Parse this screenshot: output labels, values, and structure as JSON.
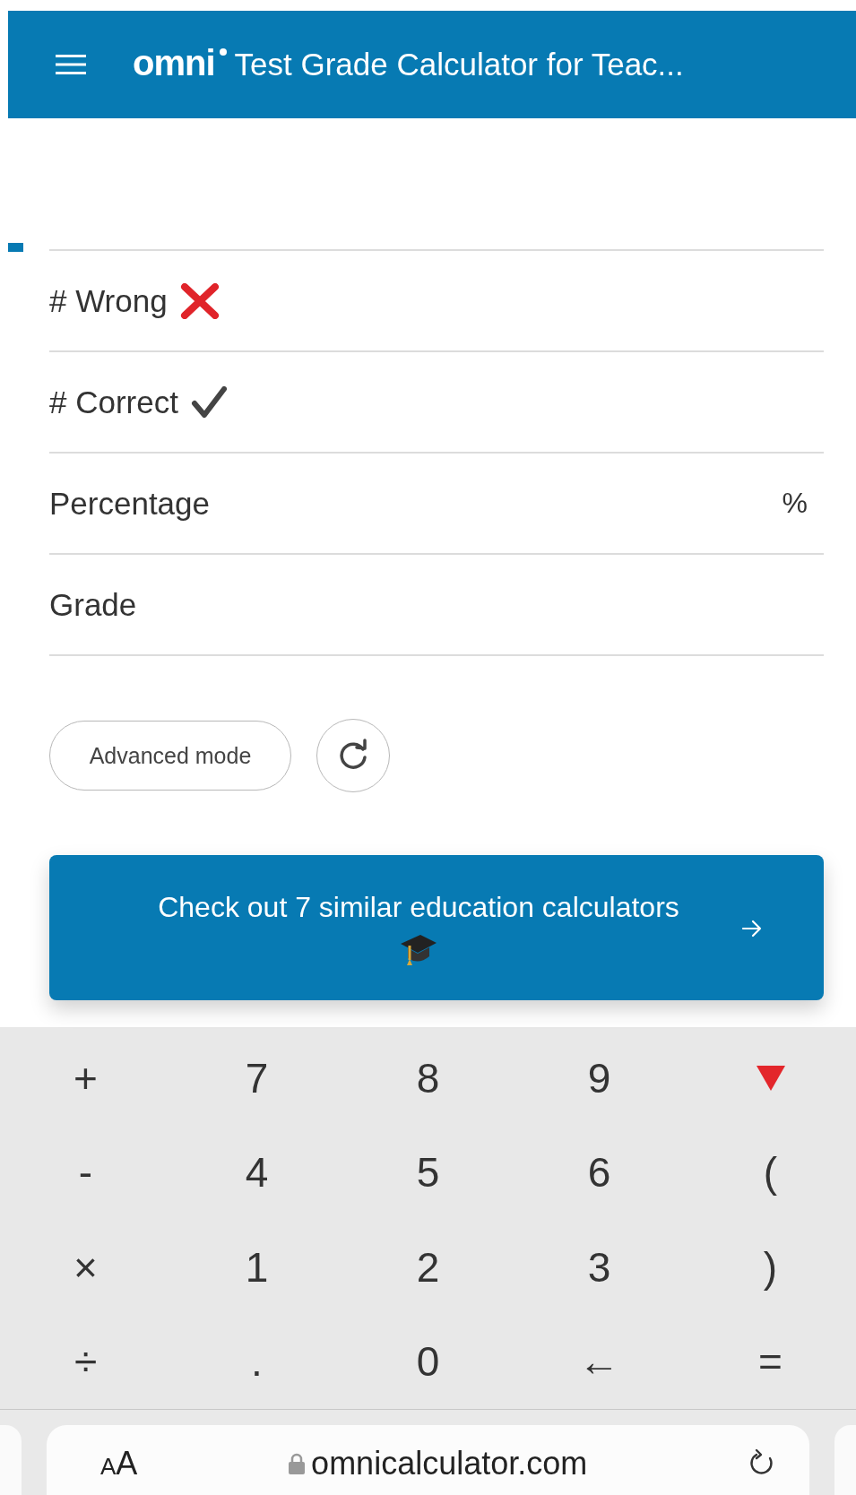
{
  "header": {
    "logo": "omni",
    "title": "Test Grade Calculator for Teac..."
  },
  "fields": [
    {
      "label": "# Wrong",
      "kind": "cross"
    },
    {
      "label": "# Correct",
      "kind": "check"
    },
    {
      "label": "Percentage",
      "kind": "unit",
      "unit": "%"
    },
    {
      "label": "Grade",
      "kind": "plain"
    }
  ],
  "actions": {
    "advanced_label": "Advanced mode"
  },
  "banner": {
    "text": "Check out 7 similar education calculators"
  },
  "keypad": [
    [
      {
        "kind": "char",
        "label": "+"
      },
      {
        "kind": "char",
        "label": "7"
      },
      {
        "kind": "char",
        "label": "8"
      },
      {
        "kind": "char",
        "label": "9"
      },
      {
        "kind": "triangle"
      }
    ],
    [
      {
        "kind": "char",
        "label": "-"
      },
      {
        "kind": "char",
        "label": "4"
      },
      {
        "kind": "char",
        "label": "5"
      },
      {
        "kind": "char",
        "label": "6"
      },
      {
        "kind": "char",
        "label": "("
      }
    ],
    [
      {
        "kind": "char",
        "label": "×"
      },
      {
        "kind": "char",
        "label": "1"
      },
      {
        "kind": "char",
        "label": "2"
      },
      {
        "kind": "char",
        "label": "3"
      },
      {
        "kind": "char",
        "label": ")"
      }
    ],
    [
      {
        "kind": "char",
        "label": "÷"
      },
      {
        "kind": "char",
        "label": "."
      },
      {
        "kind": "char",
        "label": "0"
      },
      {
        "kind": "char",
        "label": "←"
      },
      {
        "kind": "char",
        "label": "="
      }
    ]
  ],
  "browser_bar": {
    "text_size": "AA",
    "url": "omnicalculator.com"
  }
}
